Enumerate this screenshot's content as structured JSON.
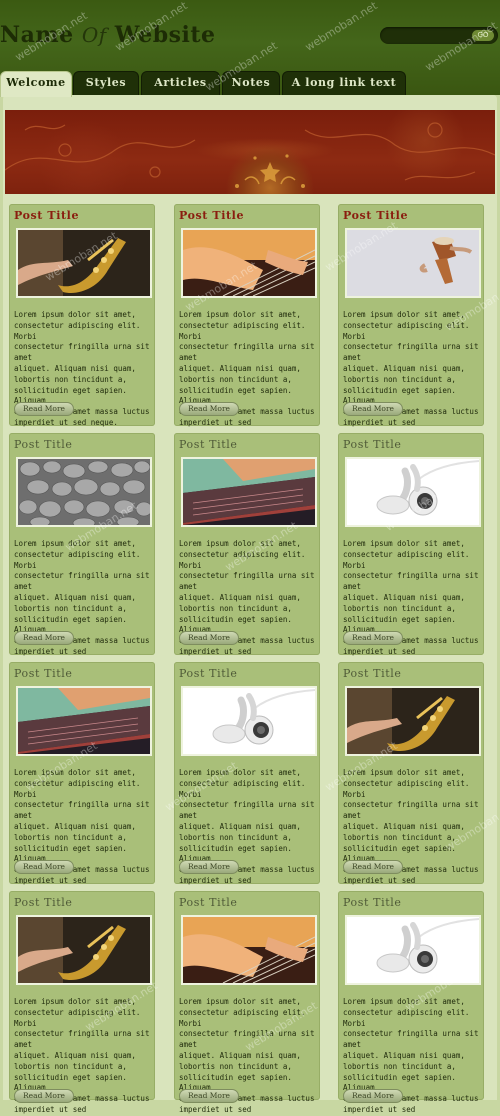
{
  "header": {
    "title_part1": "Name",
    "title_of": "Of",
    "title_part2": "Website",
    "search_button": "GO"
  },
  "nav": {
    "tabs": [
      {
        "label": "Welcome",
        "active": true
      },
      {
        "label": "Styles",
        "active": false
      },
      {
        "label": "Articles",
        "active": false
      },
      {
        "label": "Notes",
        "active": false
      },
      {
        "label": "A long link text",
        "active": false
      }
    ]
  },
  "posts": [
    {
      "title": "Post Title",
      "image": "saxophone",
      "text": "Lorem ipsum dolor sit amet,\nconsectetur adipiscing elit. Morbi\nconsectetur fringilla urna sit amet\naliquet. Aliquam nisi quam,\nlobortis non tincidunt a,\nsollicitudin eget sapien. Aliquam\neu justo sit amet massa luctus\nimperdiet ut sed neque.",
      "button": "Read More"
    },
    {
      "title": "Post Title",
      "image": "guitar",
      "text": "Lorem ipsum dolor sit amet,\nconsectetur adipiscing elit. Morbi\nconsectetur fringilla urna sit amet\naliquet. Aliquam nisi quam,\nlobortis non tincidunt a,\nsollicitudin eget sapien. Aliquam\neu justo sit amet massa luctus\nimperdiet ut sed",
      "button": "Read More"
    },
    {
      "title": "Post Title",
      "image": "drums",
      "text": "Lorem ipsum dolor sit amet,\nconsectetur adipiscing elit. Morbi\nconsectetur fringilla urna sit amet\naliquet. Aliquam nisi quam,\nlobortis non tincidunt a,\nsollicitudin eget sapien. Aliquam\neu justo sit amet massa luctus\nimperdiet ut sed",
      "button": "Read More"
    },
    {
      "title": "Post Title",
      "image": "stones",
      "text": "Lorem ipsum dolor sit amet,\nconsectetur adipiscing elit. Morbi\nconsectetur fringilla urna sit amet\naliquet. Aliquam nisi quam,\nlobortis non tincidunt a,\nsollicitudin eget sapien. Aliquam\neu justo sit amet massa luctus\nimperdiet ut sed",
      "button": "Read More"
    },
    {
      "title": "Post Title",
      "image": "laptop",
      "text": "Lorem ipsum dolor sit amet,\nconsectetur adipiscing elit. Morbi\nconsectetur fringilla urna sit amet\naliquet. Aliquam nisi quam,\nlobortis non tincidunt a,\nsollicitudin eget sapien. Aliquam\neu justo sit amet massa luctus\nimperdiet ut sed",
      "button": "Read More"
    },
    {
      "title": "Post Title",
      "image": "earbuds",
      "text": "Lorem ipsum dolor sit amet,\nconsectetur adipiscing elit. Morbi\nconsectetur fringilla urna sit amet\naliquet. Aliquam nisi quam,\nlobortis non tincidunt a,\nsollicitudin eget sapien. Aliquam\neu justo sit amet massa luctus\nimperdiet ut sed",
      "button": "Read More"
    },
    {
      "title": "Post Title",
      "image": "laptop",
      "text": "Lorem ipsum dolor sit amet,\nconsectetur adipiscing elit. Morbi\nconsectetur fringilla urna sit amet\naliquet. Aliquam nisi quam,\nlobortis non tincidunt a,\nsollicitudin eget sapien. Aliquam\neu justo sit amet massa luctus\nimperdiet ut sed",
      "button": "Read More"
    },
    {
      "title": "Post Title",
      "image": "earbuds",
      "text": "Lorem ipsum dolor sit amet,\nconsectetur adipiscing elit. Morbi\nconsectetur fringilla urna sit amet\naliquet. Aliquam nisi quam,\nlobortis non tincidunt a,\nsollicitudin eget sapien. Aliquam\neu justo sit amet massa luctus\nimperdiet ut sed",
      "button": "Read More"
    },
    {
      "title": "Post Title",
      "image": "saxophone",
      "text": "Lorem ipsum dolor sit amet,\nconsectetur adipiscing elit. Morbi\nconsectetur fringilla urna sit amet\naliquet. Aliquam nisi quam,\nlobortis non tincidunt a,\nsollicitudin eget sapien. Aliquam\neu justo sit amet massa luctus\nimperdiet ut sed",
      "button": "Read More"
    },
    {
      "title": "Post Title",
      "image": "saxophone",
      "text": "Lorem ipsum dolor sit amet,\nconsectetur adipiscing elit. Morbi\nconsectetur fringilla urna sit amet\naliquet. Aliquam nisi quam,\nlobortis non tincidunt a,\nsollicitudin eget sapien. Aliquam\neu justo sit amet massa luctus\nimperdiet ut sed",
      "button": "Read More"
    },
    {
      "title": "Post Title",
      "image": "guitar",
      "text": "Lorem ipsum dolor sit amet,\nconsectetur adipiscing elit. Morbi\nconsectetur fringilla urna sit amet\naliquet. Aliquam nisi quam,\nlobortis non tincidunt a,\nsollicitudin eget sapien. Aliquam\neu justo sit amet massa luctus\nimperdiet ut sed",
      "button": "Read More"
    },
    {
      "title": "Post Title",
      "image": "earbuds",
      "text": "Lorem ipsum dolor sit amet,\nconsectetur adipiscing elit. Morbi\nconsectetur fringilla urna sit amet\naliquet. Aliquam nisi quam,\nlobortis non tincidunt a,\nsollicitudin eget sapien. Aliquam\neu justo sit amet massa luctus\nimperdiet ut sed",
      "button": "Read More"
    }
  ],
  "watermark": "webmoban.net",
  "colors": {
    "header_green": "#44661a",
    "page_background": "#c8d7a2",
    "card_background": "#a9bf79",
    "post_title_red": "#8a1d0f",
    "banner_red": "#8d2a12"
  }
}
